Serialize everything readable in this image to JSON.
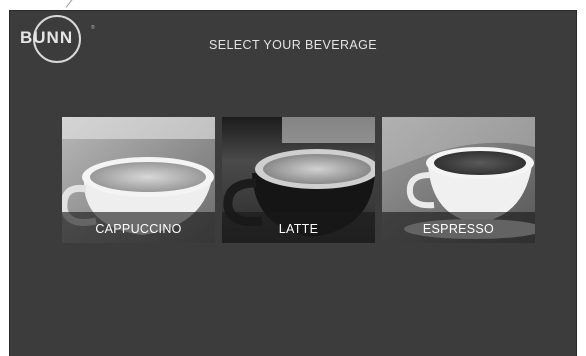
{
  "logo": {
    "text": "BUNN",
    "trademark": "®"
  },
  "header": {
    "title": "SELECT YOUR BEVERAGE"
  },
  "beverages": [
    {
      "label": "CAPPUCCINO",
      "photo": "cappuccino-cup-photo"
    },
    {
      "label": "LATTE",
      "photo": "latte-cup-photo"
    },
    {
      "label": "ESPRESSO",
      "photo": "espresso-cup-photo"
    }
  ]
}
